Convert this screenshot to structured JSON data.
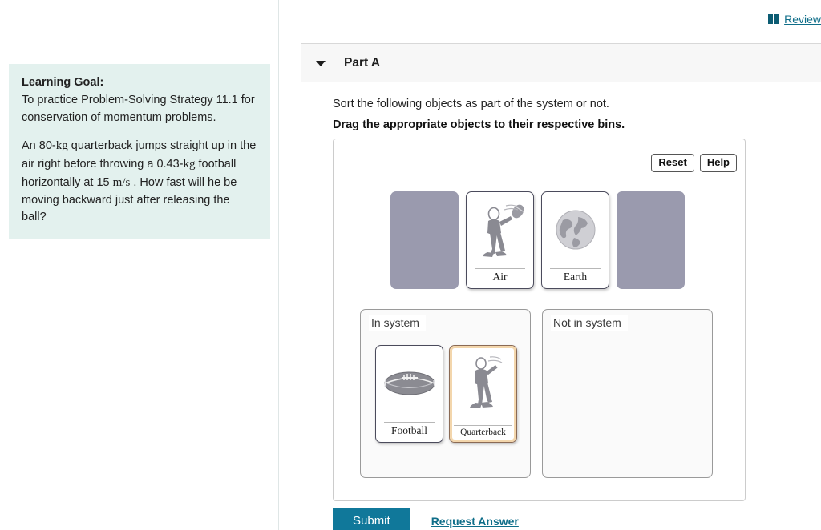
{
  "review": {
    "icon": "book-icon",
    "label": "Review"
  },
  "part": {
    "caret_icon": "chevron-down-icon",
    "title": "Part A"
  },
  "prompts": {
    "line1": "Sort the following objects as part of the system or not.",
    "line2": "Drag the appropriate objects to their respective bins."
  },
  "learning_goal": {
    "heading": "Learning Goal:",
    "goal_prefix": "To practice Problem-Solving Strategy 11.1 for ",
    "goal_link": "conservation of momentum",
    "goal_suffix": " problems.",
    "problem": "An 80-kg quarterback jumps straight up in the air right before throwing a 0.43-kg football horizontally at 15 m/s . How fast will he be moving backward just after releasing the ball?"
  },
  "toolbar": {
    "reset_label": "Reset",
    "help_label": "Help"
  },
  "tray": {
    "items": [
      {
        "type": "empty-slot",
        "label": ""
      },
      {
        "type": "card",
        "label": "Air",
        "art": "quarterback-throwing-icon"
      },
      {
        "type": "card",
        "label": "Earth",
        "art": "globe-icon"
      },
      {
        "type": "empty-slot",
        "label": ""
      }
    ]
  },
  "bins": [
    {
      "label": "In system",
      "items": [
        {
          "label": "Football",
          "art": "football-icon",
          "selected": false
        },
        {
          "label": "Quarterback",
          "art": "quarterback-jumping-icon",
          "selected": true
        }
      ]
    },
    {
      "label": "Not in system",
      "items": []
    }
  ],
  "footer": {
    "submit_label": "Submit",
    "request_answer_label": "Request Answer"
  },
  "colors": {
    "accent_teal": "#10789a",
    "link_teal": "#0f6e89",
    "learning_goal_bg": "#e3f1ee",
    "empty_slot": "#9a9aae",
    "selected_outline": "#f3d6ac",
    "part_header_bg": "#f7f7f7"
  }
}
